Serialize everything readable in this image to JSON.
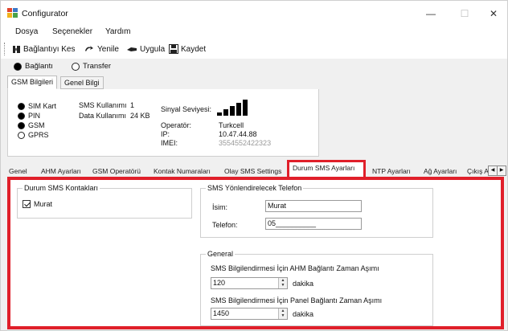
{
  "window": {
    "title": "Configurator",
    "minimize": "—",
    "maximize": "☐",
    "close": "✕"
  },
  "menu": [
    "Dosya",
    "Seçenekler",
    "Yardım"
  ],
  "toolbar": {
    "disconnect": "Bağlantıyı Kes",
    "refresh": "Yenile",
    "apply": "Uygula",
    "save": "Kaydet"
  },
  "mode": {
    "connection": "Bağlantı",
    "transfer": "Transfer",
    "selected": "connection"
  },
  "top_tabs": {
    "gsm_info": "GSM Bilgileri",
    "general_info": "Genel Bilgi"
  },
  "gsm": {
    "status": [
      "SIM Kart",
      "PIN",
      "GSM",
      "GPRS"
    ],
    "status_filled": [
      true,
      true,
      true,
      false
    ],
    "sms_usage_label": "SMS Kullanımı",
    "sms_usage_value": "1",
    "data_usage_label": "Data Kullanımı",
    "data_usage_value": "24 KB",
    "signal_label": "Sinyal Seviyesi:",
    "signal_bars": 5,
    "operator_label": "Operatör:",
    "operator_value": "Turkcell",
    "ip_label": "IP:",
    "ip_value": "10.47.44.88",
    "imei_label": "IMEI:",
    "imei_value": "3554552422323"
  },
  "bottom_tabs": [
    "Genel",
    "AHM Ayarları",
    "GSM Operatörü",
    "Kontak Numaraları",
    "Olay SMS Settings",
    "Durum SMS Ayarları",
    "NTP Ayarları",
    "Ağ Ayarları",
    "Çıkış A"
  ],
  "active_tab": "Durum SMS Ayarları",
  "sms_contacts": {
    "title": "Durum SMS Kontakları",
    "items": [
      {
        "name": "Murat",
        "checked": true
      }
    ]
  },
  "forward_phone": {
    "title": "SMS Yönlendirelecek Telefon",
    "name_label": "İsim:",
    "name_value": "Murat",
    "phone_label": "Telefon:",
    "phone_value": "05__________"
  },
  "general": {
    "title": "General",
    "ahm_label": "SMS Bilgilendirmesi İçin AHM Bağlantı Zaman Aşımı",
    "ahm_value": "120",
    "ahm_unit": "dakika",
    "panel_label": "SMS Bilgilendirmesi İçin Panel Bağlantı Zaman Aşımı",
    "panel_value": "1450",
    "panel_unit": "dakika"
  },
  "colors": {
    "highlight": "#e01f2a"
  }
}
